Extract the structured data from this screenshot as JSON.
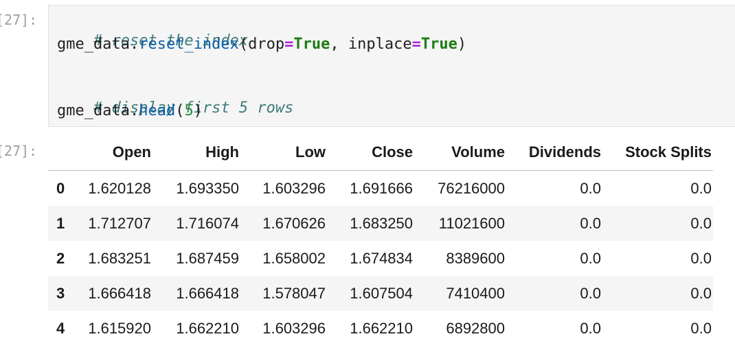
{
  "notebook": {
    "input_prompt": "[27]:",
    "output_prompt": "[27]:",
    "code": {
      "line1": "# reset the index",
      "line2_obj": "gme_data.",
      "line2_fn": "reset_index",
      "line2_p1": "(drop",
      "line2_eq1": "=",
      "line2_kw1": "True",
      "line2_p2": ", inplace",
      "line2_eq2": "=",
      "line2_kw2": "True",
      "line2_p3": ")",
      "line4": "# display first 5 rows",
      "line5_obj": "gme_data.",
      "line5_fn": "head",
      "line5_p1": "(",
      "line5_num": "5",
      "line5_p2": ")"
    },
    "table": {
      "columns": [
        "",
        "Open",
        "High",
        "Low",
        "Close",
        "Volume",
        "Dividends",
        "Stock Splits"
      ],
      "rows": [
        [
          "0",
          "1.620128",
          "1.693350",
          "1.603296",
          "1.691666",
          "76216000",
          "0.0",
          "0.0"
        ],
        [
          "1",
          "1.712707",
          "1.716074",
          "1.670626",
          "1.683250",
          "11021600",
          "0.0",
          "0.0"
        ],
        [
          "2",
          "1.683251",
          "1.687459",
          "1.658002",
          "1.674834",
          "8389600",
          "0.0",
          "0.0"
        ],
        [
          "3",
          "1.666418",
          "1.666418",
          "1.578047",
          "1.607504",
          "7410400",
          "0.0",
          "0.0"
        ],
        [
          "4",
          "1.615920",
          "1.662210",
          "1.603296",
          "1.662210",
          "6892800",
          "0.0",
          "0.0"
        ]
      ]
    }
  }
}
